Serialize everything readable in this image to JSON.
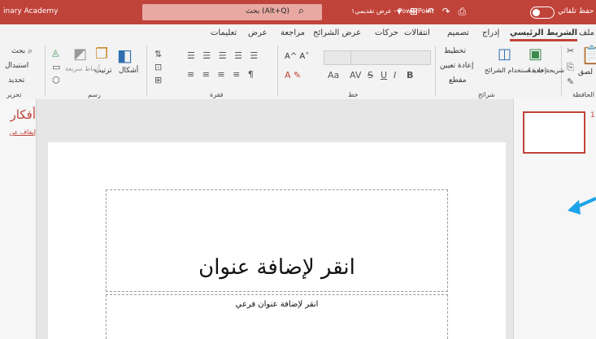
{
  "titlebar": {
    "academy": "inary Academy",
    "search_label": "بحث (Alt+Q)",
    "doc_title": "عرض تقديمي١ - PowerPoint",
    "autosave": "حفظ تلقائي"
  },
  "tabs": {
    "file": "ملف",
    "home": "الشريط الرئيسي",
    "insert": "إدراج",
    "design": "تصميم",
    "transitions": "انتقالات",
    "animations": "حركات",
    "slideshow": "عرض الشرائح",
    "review": "مراجعة",
    "view": "عرض",
    "help": "تعليمات"
  },
  "ribbon": {
    "clipboard": {
      "label": "الحافظة",
      "paste": "لصق"
    },
    "slides": {
      "label": "شرائح",
      "new_slide": "شريحة جديدة",
      "reuse": "إعادة استخدام الشرائح",
      "layout": "تخطيط",
      "reset": "إعادة تعيين",
      "section": "مقطع"
    },
    "font": {
      "label": "خط",
      "font_size_down": "Aa",
      "bold": "B",
      "italic": "I",
      "underline": "U",
      "strike": "S",
      "spacing": "AV"
    },
    "paragraph": {
      "label": "فقرة"
    },
    "drawing": {
      "label": "رسم",
      "shapes": "أشكال",
      "arrange": "ترتيب",
      "quick_styles": "أنماط سريعة"
    },
    "editing": {
      "label": "تحرير",
      "find": "بحث",
      "replace": "استبدال",
      "select": "تحديد"
    }
  },
  "leftpane": {
    "big": "أفكار",
    "link": "إيقاف عن"
  },
  "slide": {
    "title_placeholder": "انقر لإضافة عنوان",
    "subtitle_placeholder": "انقر لإضافة عنوان فرعي"
  },
  "thumbnails": {
    "first_number": "1"
  },
  "colors": {
    "accent": "#c0433a",
    "arrow": "#1aa3e8"
  }
}
